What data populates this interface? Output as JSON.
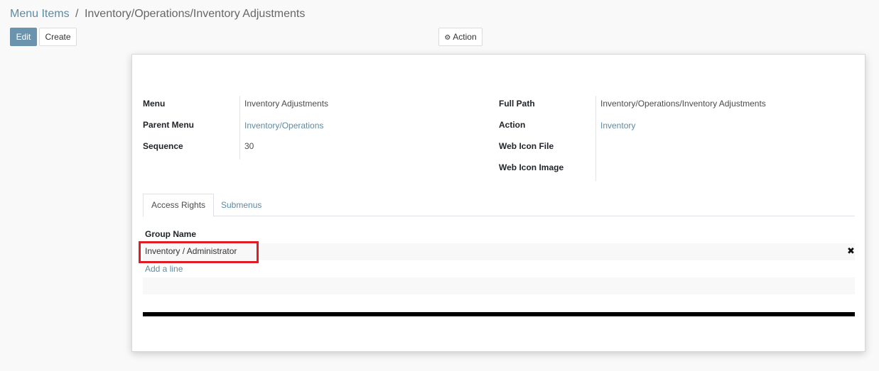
{
  "breadcrumb": {
    "parent": "Menu Items",
    "separator": "/",
    "current": "Inventory/Operations/Inventory Adjustments"
  },
  "toolbar": {
    "edit_label": "Edit",
    "create_label": "Create",
    "action_label": "Action",
    "action_icon": "gear-icon"
  },
  "form": {
    "left": [
      {
        "label": "Menu",
        "value": "Inventory Adjustments",
        "link": false
      },
      {
        "label": "Parent Menu",
        "value": "Inventory/Operations",
        "link": true
      },
      {
        "label": "Sequence",
        "value": "30",
        "link": false
      }
    ],
    "right": [
      {
        "label": "Full Path",
        "value": "Inventory/Operations/Inventory Adjustments",
        "link": false
      },
      {
        "label": "Action",
        "value": "Inventory",
        "link": true
      },
      {
        "label": "Web Icon File",
        "value": ""
      },
      {
        "label": "Web Icon Image",
        "value": ""
      }
    ]
  },
  "tabs": [
    {
      "label": "Access Rights",
      "active": true
    },
    {
      "label": "Submenus",
      "active": false
    }
  ],
  "access_rights": {
    "column_header": "Group Name",
    "rows": [
      {
        "group_name": "Inventory / Administrator"
      }
    ],
    "add_line_label": "Add a line",
    "delete_icon": "✖"
  },
  "colors": {
    "link": "#5f8aa3",
    "primary_button": "#6c93ad",
    "highlight": "#e21c24"
  }
}
